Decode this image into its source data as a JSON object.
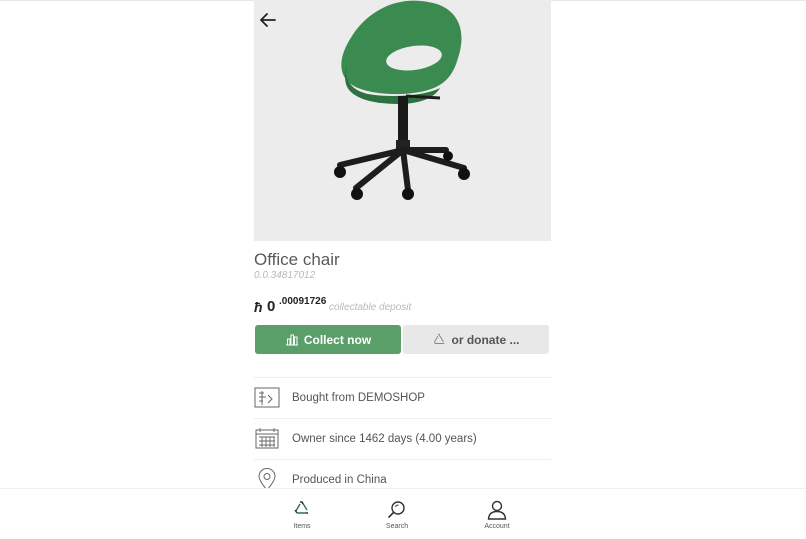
{
  "item": {
    "title": "Office chair",
    "id": "0.0.34817012",
    "price_symbol": "ħ",
    "price_int": "0",
    "price_dec": ".00091726",
    "price_note": "collectable deposit"
  },
  "actions": {
    "collect_label": "Collect now",
    "donate_label": "or donate ..."
  },
  "details": [
    {
      "icon": "shop-icon",
      "text": "Bought from DEMOSHOP"
    },
    {
      "icon": "calendar-icon",
      "text": "Owner since 1462 days (4.00 years)"
    },
    {
      "icon": "location-pin-icon",
      "text": "Produced in China"
    }
  ],
  "nav": {
    "items": [
      {
        "icon": "recycle-icon",
        "label": "Items"
      },
      {
        "icon": "search-icon",
        "label": "Search"
      },
      {
        "icon": "user-icon",
        "label": "Account"
      }
    ]
  },
  "colors": {
    "accent": "#5a9e6a",
    "chair": "#3b8a4f",
    "hero_bg": "#ececec"
  }
}
